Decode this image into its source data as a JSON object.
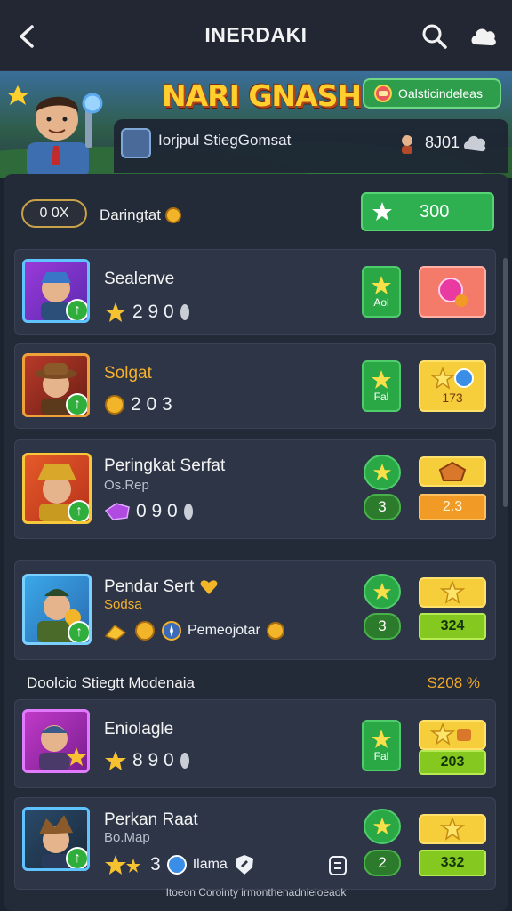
{
  "header": {
    "title": "INERDAKI"
  },
  "banner": {
    "game_title": "NARI GNASH!",
    "button_label": "Oalsticindeleas",
    "strip_text": "Iorjpul StiegGomsat",
    "strip_value": "8J01"
  },
  "top_row": {
    "pill": "0 0X",
    "label": "Daringtat",
    "green_value": "300"
  },
  "cards": [
    {
      "name": "Sealenve",
      "stat": "2 9 0",
      "btn1": "Aol"
    },
    {
      "name": "Solgat",
      "stat": "2 0 3",
      "btn1": "Fal",
      "btn2": "173"
    },
    {
      "name": "Peringkat Serfat",
      "sub": "Os.Rep",
      "stat": "0 9 0",
      "num": "3",
      "bar": "2.3"
    },
    {
      "name": "Pendar Sert",
      "sub": "Sodsa",
      "extra": "Pemeojotar",
      "num": "3",
      "bar": "324"
    },
    {
      "name": "Eniolagle",
      "stat": "8 9 0",
      "btn1": "Fal",
      "bar": "203"
    },
    {
      "name": "Perkan Raat",
      "sub": "Bo.Map",
      "stat": "3",
      "extra": "Ilama",
      "num": "2",
      "bar": "332"
    }
  ],
  "section": {
    "left": "Doolcio Stiegtt Modenaia",
    "right": "S208 %"
  },
  "footer": "Itoeon Corointy irmonthenadnieioeaok",
  "colors": {
    "accent_green": "#2fb050",
    "gold": "#f6b12b",
    "panel": "#232a38"
  }
}
